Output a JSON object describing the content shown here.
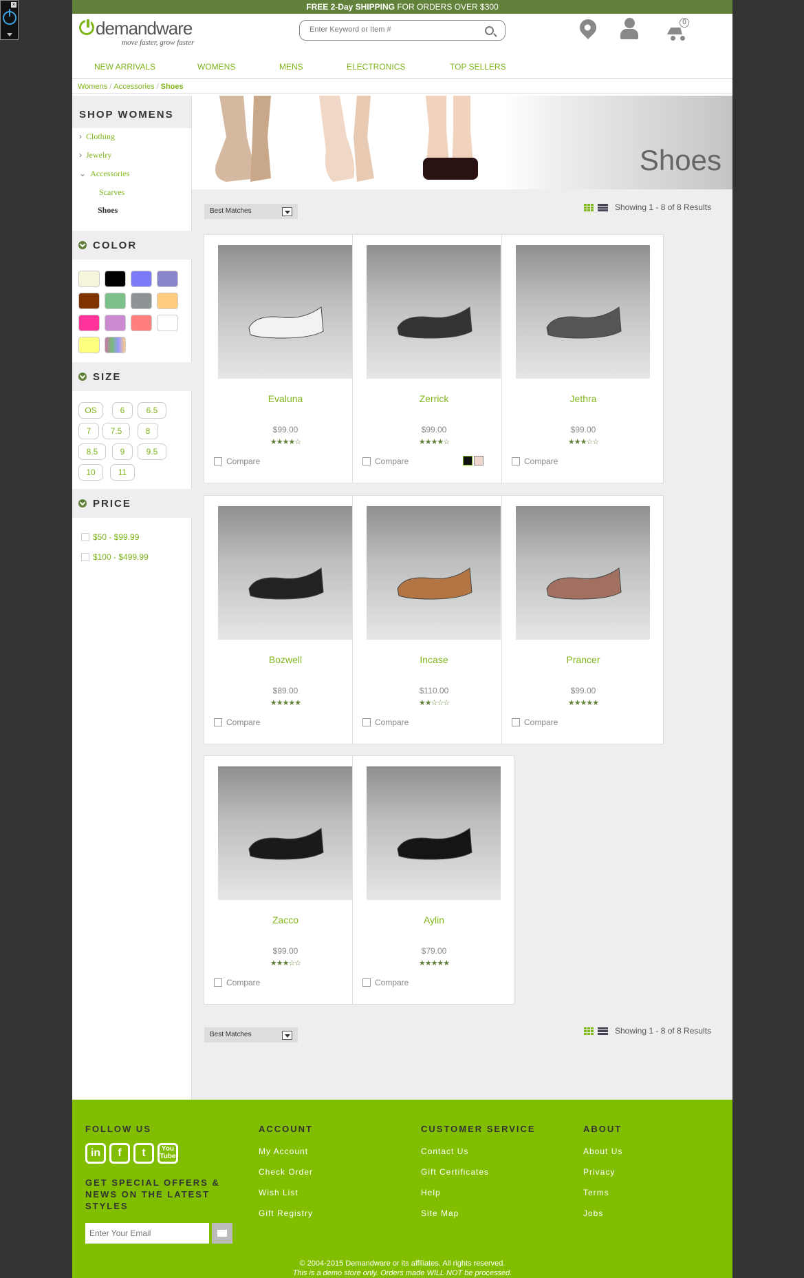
{
  "promo": {
    "bold1": "FREE 2-Day",
    "bold2": "SHIPPING",
    "rest": " FOR ORDERS OVER $300"
  },
  "logo": {
    "name": "demandware",
    "tagline": "move faster, grow faster"
  },
  "search": {
    "placeholder": "Enter Keyword or Item #"
  },
  "cart": {
    "count": "0"
  },
  "nav": [
    "NEW ARRIVALS",
    "WOMENS",
    "MENS",
    "ELECTRONICS",
    "TOP SELLERS"
  ],
  "breadcrumb": [
    "Womens",
    "Accessories",
    "Shoes"
  ],
  "sidebar": {
    "title": "SHOP WOMENS",
    "categories": [
      "Clothing",
      "Jewelry",
      "Accessories"
    ],
    "subcategories": [
      "Scarves",
      "Shoes"
    ],
    "color_title": "COLOR",
    "colors": [
      "#f5f5dc",
      "#000000",
      "#7b7bf7",
      "#8a86cc",
      "#7f3300",
      "#7cc08a",
      "#8e9496",
      "#ffcc80",
      "#ff3399",
      "#cc8ad0",
      "#ff7f7f",
      "#ffffff",
      "#ffff7f",
      "multicolor"
    ],
    "size_title": "SIZE",
    "sizes": [
      "OS",
      "6",
      "6.5",
      "7",
      "7.5",
      "8",
      "8.5",
      "9",
      "9.5",
      "10",
      "11"
    ],
    "price_title": "PRICE",
    "prices": [
      "$50 - $99.99",
      "$100 - $499.99"
    ]
  },
  "banner": {
    "text": "Shoes"
  },
  "sort": {
    "label": "Best Matches"
  },
  "results": {
    "text": "Showing 1 - 8 of 8 Results"
  },
  "products": [
    {
      "name": "Evaluna",
      "price": "$99.00",
      "stars": "★★★★☆",
      "compare": "Compare",
      "shoe_color": "#f2f2f2"
    },
    {
      "name": "Zerrick",
      "price": "$99.00",
      "stars": "★★★★☆",
      "compare": "Compare",
      "shoe_color": "#333333"
    },
    {
      "name": "Jethra",
      "price": "$99.00",
      "stars": "★★★☆☆",
      "compare": "Compare",
      "shoe_color": "#555555"
    },
    {
      "name": "Bozwell",
      "price": "$89.00",
      "stars": "★★★★★",
      "compare": "Compare",
      "shoe_color": "#222222"
    },
    {
      "name": "Incase",
      "price": "$110.00",
      "stars": "★★☆☆☆",
      "compare": "Compare",
      "shoe_color": "#b37544"
    },
    {
      "name": "Prancer",
      "price": "$99.00",
      "stars": "★★★★★",
      "compare": "Compare",
      "shoe_color": "#a17060"
    },
    {
      "name": "Zacco",
      "price": "$99.00",
      "stars": "★★★☆☆",
      "compare": "Compare",
      "shoe_color": "#1a1a1a"
    },
    {
      "name": "Aylin",
      "price": "$79.00",
      "stars": "★★★★★",
      "compare": "Compare",
      "shoe_color": "#151515"
    }
  ],
  "footer": {
    "follow": "FOLLOW US",
    "account": {
      "title": "ACCOUNT",
      "links": [
        "My Account",
        "Check Order",
        "Wish List",
        "Gift Registry"
      ]
    },
    "service": {
      "title": "CUSTOMER SERVICE",
      "links": [
        "Contact Us",
        "Gift Certificates",
        "Help",
        "Site Map"
      ]
    },
    "about": {
      "title": "ABOUT",
      "links": [
        "About Us",
        "Privacy",
        "Terms",
        "Jobs"
      ]
    },
    "offers": "GET SPECIAL OFFERS & NEWS ON THE LATEST STYLES",
    "email_placeholder": "Enter Your Email",
    "copyright": "© 2004-2015 Demandware or its affiliates. All rights reserved.",
    "demo": "This is a demo store only. Orders made WILL NOT be processed."
  }
}
